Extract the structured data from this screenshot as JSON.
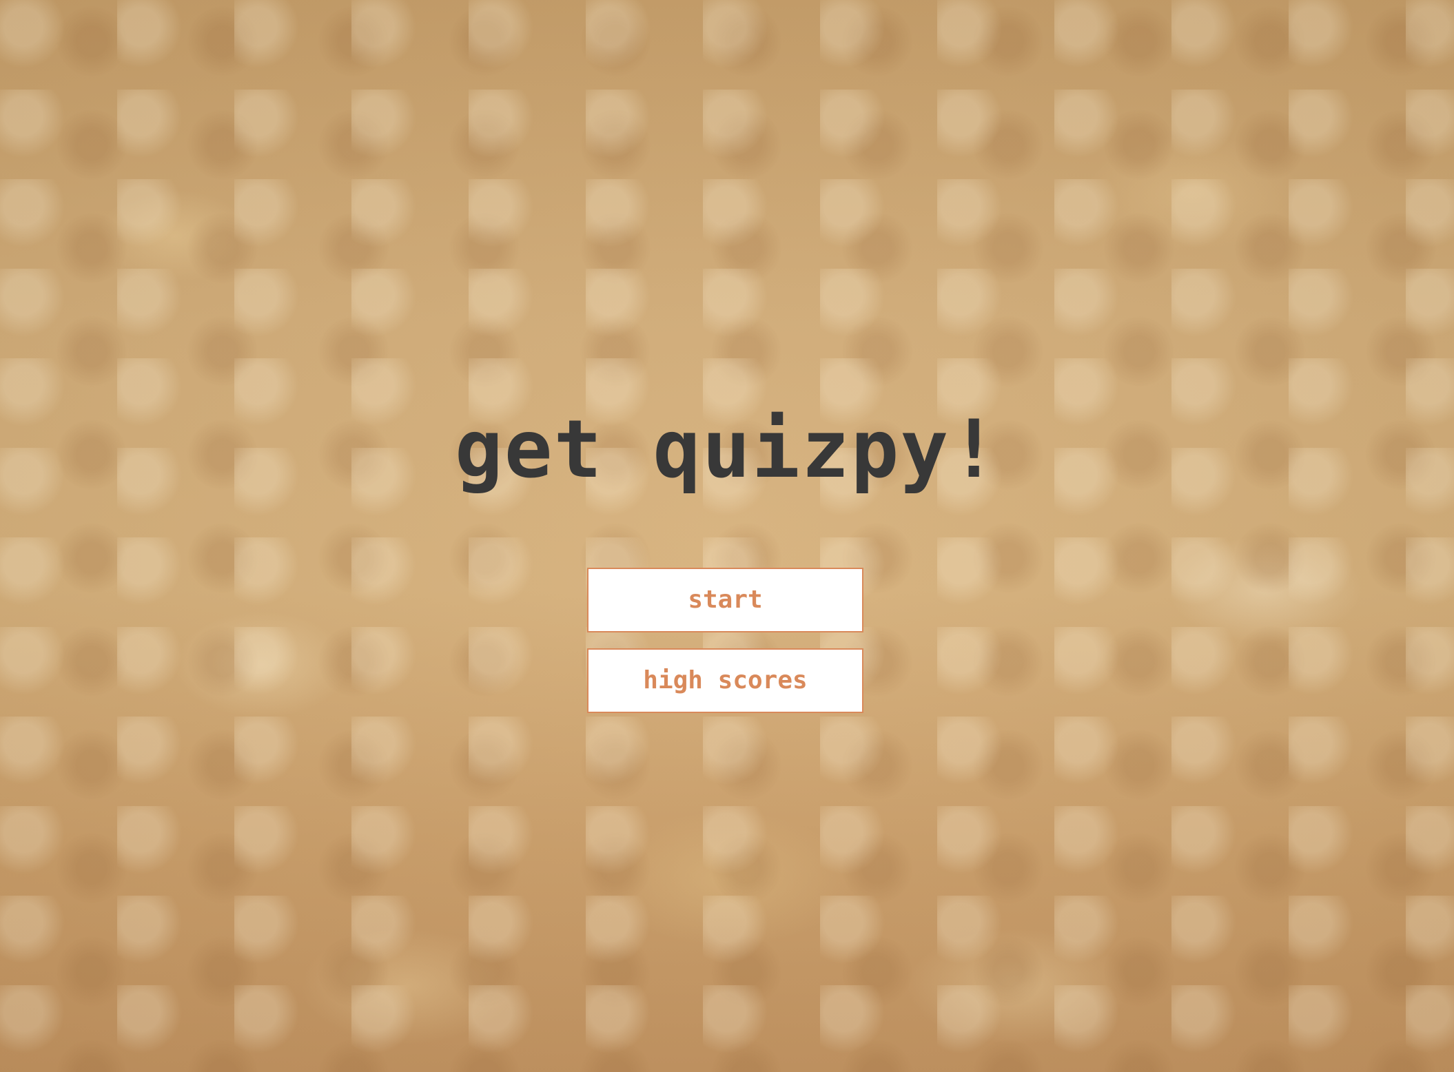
{
  "app": {
    "title": "get quizpy!"
  },
  "menu": {
    "start_label": "start",
    "high_scores_label": "high scores"
  },
  "colors": {
    "title": "#383838",
    "button_text": "#d9895a",
    "button_border": "#d9895a",
    "button_background": "#ffffff"
  }
}
